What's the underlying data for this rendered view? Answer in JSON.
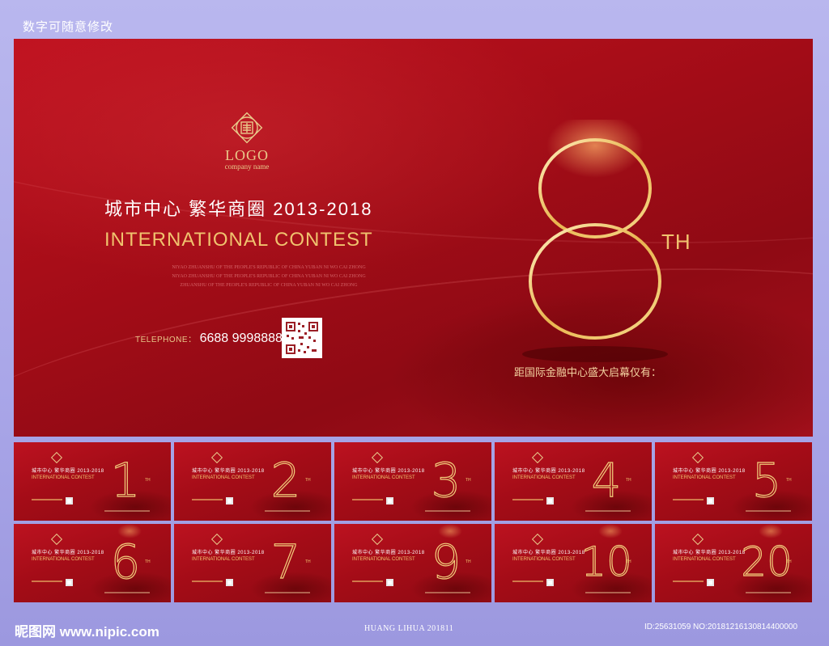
{
  "top_caption": "数字可随意修改",
  "main_card": {
    "logo_text": "LOGO",
    "logo_subtitle": "company name",
    "headline_cn": "城市中心  繁华商圈  2013-2018",
    "headline_en": "INTERNATIONAL CONTEST",
    "subtext_lines": [
      "NIYAO  ZHUANSHU   OF THE PEOPLE'S REPUBLIC OF CHINA YUBAN   NI WO   CAI ZHONG",
      "NIYAO  ZHUANSHU   OF THE PEOPLE'S REPUBLIC OF CHINA YUBAN   NI WO   CAI ZHONG",
      "ZHUANSHU   OF THE PEOPLE'S REPUBLIC OF CHINA YUBAN   NI WO   CAI ZHONG"
    ],
    "phone_label": "TELEPHONE：",
    "phone_number": "6688  9998888",
    "big_number": "8",
    "big_suffix": "TH",
    "countdown_label": "距国际金融中心盛大启幕仅有：",
    "accent_gold": "#f0c36e",
    "background_red": "#a80d18"
  },
  "thumbnails": [
    {
      "number": "1",
      "suffix": "TH"
    },
    {
      "number": "2",
      "suffix": "TH"
    },
    {
      "number": "3",
      "suffix": "TH"
    },
    {
      "number": "4",
      "suffix": "TH"
    },
    {
      "number": "5",
      "suffix": "TH"
    },
    {
      "number": "6",
      "suffix": "TH"
    },
    {
      "number": "7",
      "suffix": "TH"
    },
    {
      "number": "9",
      "suffix": "TH"
    },
    {
      "number": "10",
      "suffix": "TH"
    },
    {
      "number": "20",
      "suffix": "TH"
    }
  ],
  "thumb_text": {
    "cn": "城市中心  繁华商圈  2013-2018",
    "en": "INTERNATIONAL CONTEST"
  },
  "footer": {
    "watermark": "昵图网 www.nipic.com",
    "author": "HUANG LIHUA 201811",
    "id_text": "ID:25631059 NO:20181216130814400000"
  }
}
